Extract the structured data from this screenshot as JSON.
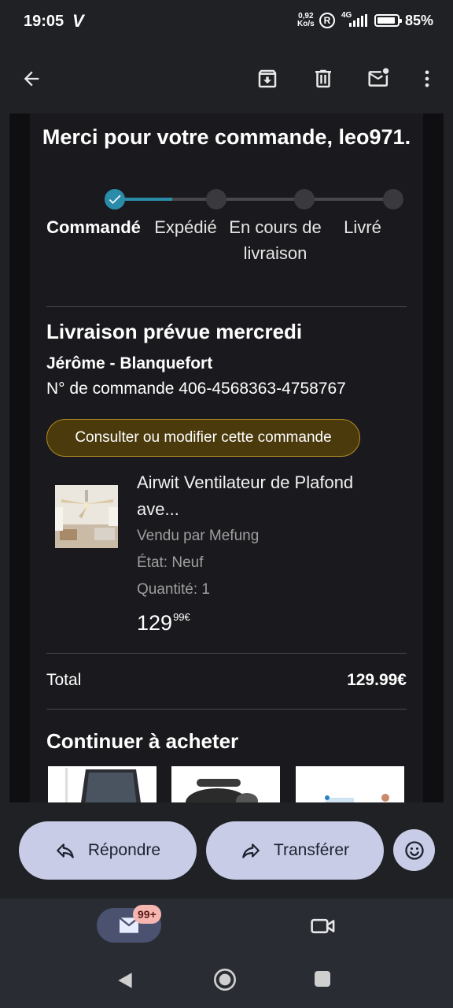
{
  "status_bar": {
    "time": "19:05",
    "speed_value": "0,92",
    "speed_unit": "Ko/s",
    "reg": "R",
    "network": "4G",
    "battery": "85%"
  },
  "toolbar": {
    "icons": [
      "back-arrow-icon",
      "archive-icon",
      "delete-icon",
      "mark-unread-icon",
      "more-vert-icon"
    ]
  },
  "email": {
    "heading": "Merci pour votre commande, leo971.",
    "steps": [
      "Commandé",
      "Expédié",
      "En cours de livraison",
      "Livré"
    ],
    "active_step": 0,
    "delivery_title": "Livraison prévue mercredi",
    "recipient": "Jérôme - Blanquefort",
    "order_number": "N° de commande 406-4568363-4758767",
    "consult_button": "Consulter ou modifier cette commande",
    "product": {
      "title": "Airwit Ventilateur de Plafond ave...",
      "seller": "Vendu par Mefung",
      "condition": "État: Neuf",
      "quantity": "Quantité: 1",
      "price_main": "129",
      "price_sup": "99€"
    },
    "total_label": "Total",
    "total_value": "129.99€",
    "continue_title": "Continuer à acheter"
  },
  "reply_bar": {
    "reply_label": "Répondre",
    "forward_label": "Transférer"
  },
  "bottom_nav": {
    "badge": "99+"
  },
  "colors": {
    "accent_progress": "#2a8ca8",
    "button_gold_border": "#b08a26",
    "pill_bg": "#c8cce6"
  }
}
